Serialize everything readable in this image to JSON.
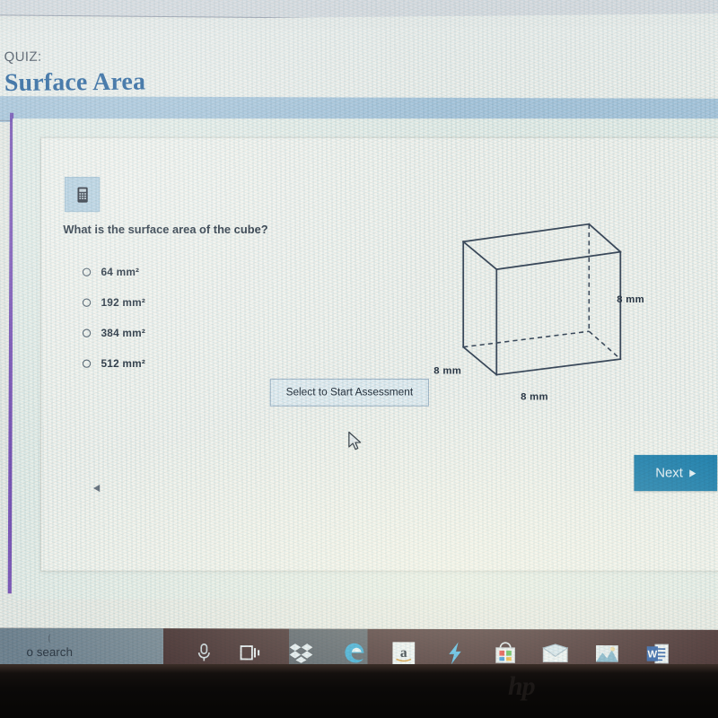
{
  "browser": {
    "chrome_visible": true
  },
  "header": {
    "kicker": "QUIZ:",
    "title": "Surface Area",
    "title_color": "#1f5f9c",
    "accent_rail_color": "#6b3fb0",
    "band_color": "#acc8dd"
  },
  "quiz": {
    "calculator_icon": "calculator-icon",
    "question": "What is the surface area of the cube?",
    "options": [
      {
        "label": "64 mm²",
        "value": "64",
        "unit": "mm²",
        "selected": false
      },
      {
        "label": "192 mm²",
        "value": "192",
        "unit": "mm²",
        "selected": false
      },
      {
        "label": "384 mm²",
        "value": "384",
        "unit": "mm²",
        "selected": false
      },
      {
        "label": "512 mm²",
        "value": "512",
        "unit": "mm²",
        "selected": false
      }
    ],
    "tooltip": "Select to Start Assessment",
    "next_label": "Next",
    "next_caret": "►",
    "next_color": "#1a7fae",
    "prev_arrow_icon": "caret-left-icon"
  },
  "figure": {
    "shape": "cube",
    "dim_right": "8 mm",
    "dim_left": "8 mm",
    "dim_bottom": "8 mm",
    "line_color": "#3c4a5c"
  },
  "taskbar": {
    "search_text": "o search",
    "items": [
      {
        "name": "microphone-icon",
        "label": "Microphone"
      },
      {
        "name": "task-view-icon",
        "label": "Task View"
      },
      {
        "name": "dropbox-icon",
        "label": "Dropbox"
      },
      {
        "name": "edge-icon",
        "label": "Microsoft Edge"
      },
      {
        "name": "amazon-icon",
        "label": "Amazon"
      },
      {
        "name": "lightning-icon",
        "label": "Lightning"
      },
      {
        "name": "microsoft-store-icon",
        "label": "Microsoft Store"
      },
      {
        "name": "mail-icon",
        "label": "Mail"
      },
      {
        "name": "photos-icon",
        "label": "Photos"
      },
      {
        "name": "word-icon",
        "label": "Microsoft Word"
      }
    ]
  },
  "device": {
    "brand_logo": "hp"
  }
}
